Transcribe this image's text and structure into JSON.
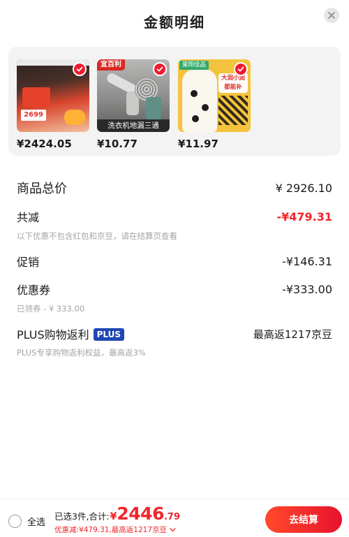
{
  "header": {
    "title": "金额明细"
  },
  "products": [
    {
      "price": "¥2424.05"
    },
    {
      "brand_tag": "宜百利",
      "caption": "洗衣机地漏三通",
      "price": "¥10.77"
    },
    {
      "brand_tag": "巢翔佳品",
      "promo": "大润小润都能补",
      "price": "¥11.97"
    }
  ],
  "details": {
    "total": {
      "label": "商品总价",
      "value": "¥ 2926.10"
    },
    "discount": {
      "label": "共减",
      "value": "-¥479.31",
      "note": "以下优惠不包含红包和京豆，请在结算页查看"
    },
    "promotion": {
      "label": "促销",
      "value": "-¥146.31"
    },
    "coupon": {
      "label": "优惠券",
      "value": "-¥333.00",
      "note": "已领券 - ¥ 333.00"
    },
    "plus": {
      "label": "PLUS购物返利",
      "badge": "PLUS",
      "value": "最高返1217京豆",
      "note": "PLUS专享购物返利权益，最高返3%"
    }
  },
  "bottom_bar": {
    "select_all_label": "全选",
    "summary_prefix": "已选3件,合计:",
    "total_currency": "¥",
    "total_integer": "2446",
    "total_decimal": ".79",
    "discount_summary": "优惠减:¥479.31,最高返1217京豆",
    "checkout_label": "去结算"
  },
  "colors": {
    "accent_red": "#f0262b",
    "plus_blue": "#1f47b4"
  }
}
